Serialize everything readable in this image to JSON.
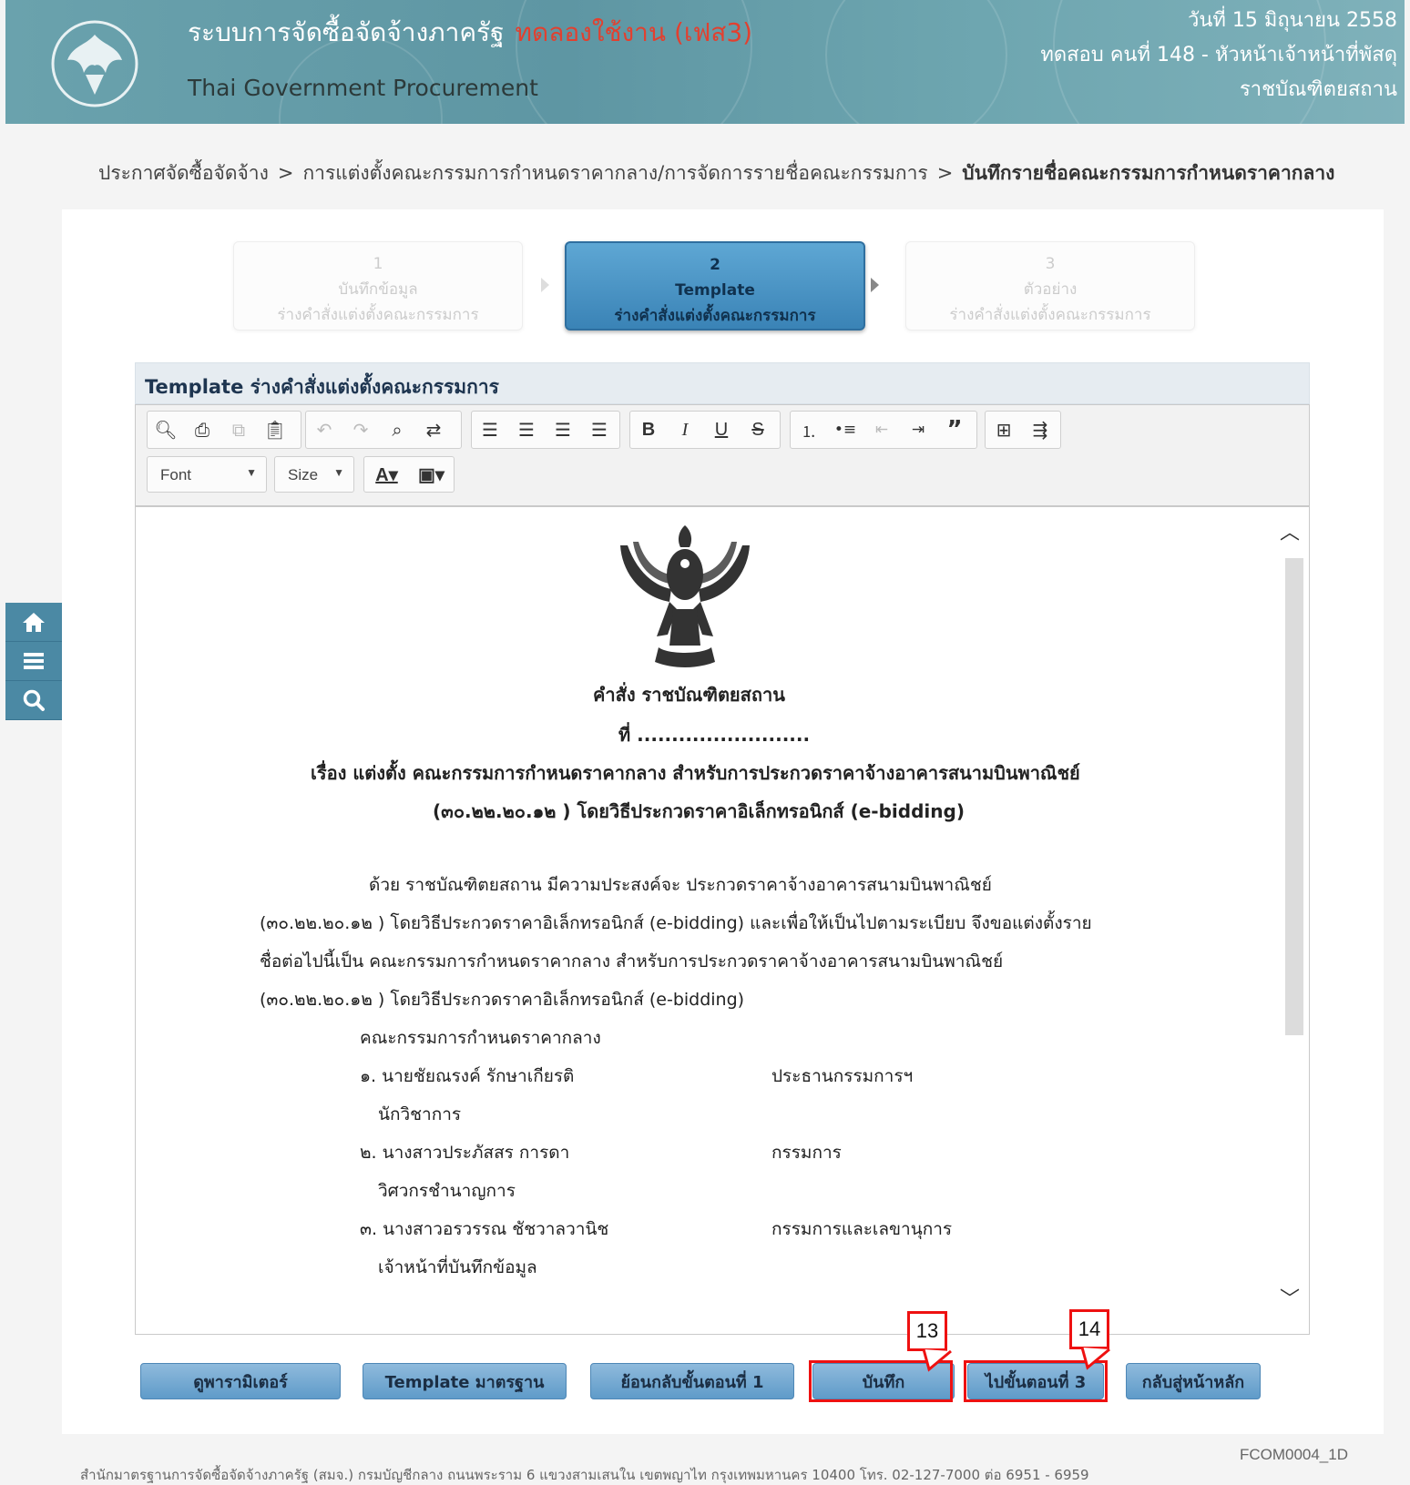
{
  "header": {
    "title": "ระบบการจัดซื้อจัดจ้างภาครัฐ",
    "trial_label": "ทดลองใช้งาน (เฟส3)",
    "subtitle": "Thai Government Procurement",
    "date": "วันที่ 15 มิถุนายน 2558",
    "user": "ทดสอบ คนที่ 148 - หัวหน้าเจ้าหน้าที่พัสดุ",
    "org": "ราชบัณฑิตยสถาน"
  },
  "breadcrumb": {
    "item1": "ประกาศจัดซื้อจัดจ้าง",
    "sep": ">",
    "item2": "การแต่งตั้งคณะกรรมการกำหนดราคากลาง/การจัดการรายชื่อคณะกรรมการ",
    "current": "บันทึกรายชื่อคณะกรรมการกำหนดราคากลาง"
  },
  "steps": [
    {
      "num": "1",
      "line1": "บันทึกข้อมูล",
      "line2": "ร่างคำสั่งแต่งตั้งคณะกรรมการ"
    },
    {
      "num": "2",
      "line1": "Template",
      "line2": "ร่างคำสั่งแต่งตั้งคณะกรรมการ"
    },
    {
      "num": "3",
      "line1": "ตัวอย่าง",
      "line2": "ร่างคำสั่งแต่งตั้งคณะกรรมการ"
    }
  ],
  "editor": {
    "title": "Template ร่างคำสั่งแต่งตั้งคณะกรรมการ",
    "font_label": "Font",
    "size_label": "Size"
  },
  "document": {
    "heading": "คำสั่ง ราชบัณฑิตยสถาน",
    "number": "ที่ .........................",
    "subject1": "เรื่อง แต่งตั้ง คณะกรรมการกำหนดราคากลาง สำหรับการประกวดราคาจ้างอาคารสนามบินพาณิชย์",
    "subject2": "(๓๐.๒๒.๒๐.๑๒ ) โดยวิธีประกวดราคาอิเล็กทรอนิกส์ (e-bidding)",
    "para1": "ด้วย ราชบัณฑิตยสถาน มีความประสงค์จะ ประกวดราคาจ้างอาคารสนามบินพาณิชย์",
    "para2": "(๓๐.๒๒.๒๐.๑๒ ) โดยวิธีประกวดราคาอิเล็กทรอนิกส์ (e-bidding)  และเพื่อให้เป็นไปตามระเบียบ จึงขอแต่งตั้งราย",
    "para3": "ชื่อต่อไปนี้เป็น คณะกรรมการกำหนดราคากลาง สำหรับการประกวดราคาจ้างอาคารสนามบินพาณิชย์",
    "para4": "(๓๐.๒๒.๒๐.๑๒ ) โดยวิธีประกวดราคาอิเล็กทรอนิกส์ (e-bidding)",
    "committee_title": "คณะกรรมการกำหนดราคากลาง",
    "members": [
      {
        "name": "๑. นายชัยณรงค์ รักษาเกียรติ",
        "position": "นักวิชาการ",
        "role": "ประธานกรรมการฯ"
      },
      {
        "name": "๒. นางสาวประภัสสร การดา",
        "position": "วิศวกรชำนาญการ",
        "role": "กรรมการ"
      },
      {
        "name": "๓. นางสาวอรวรรณ ชัชวาลวานิช",
        "position": "เจ้าหน้าที่บันทึกข้อมูล",
        "role": "กรรมการและเลขานุการ"
      }
    ]
  },
  "buttons": {
    "parameter": "ดูพารามิเตอร์",
    "template": "Template มาตรฐาน",
    "back": "ย้อนกลับขั้นตอนที่ 1",
    "save": "บันทึก",
    "next": "ไปขั้นตอนที่ 3",
    "home": "กลับสู่หน้าหลัก"
  },
  "callouts": {
    "save": "13",
    "next": "14"
  },
  "footer": {
    "text": "สำนักมาตรฐานการจัดซื้อจัดจ้างภาครัฐ (สมจ.) กรมบัญชีกลาง ถนนพระราม 6 แขวงสามเสนใน เขตพญาไท กรุงเทพมหานคร 10400 โทร. 02-127-7000 ต่อ 6951 - 6959",
    "code": "FCOM0004_1D"
  },
  "colors": {
    "header": "#6aa2ad",
    "trial": "#e2402f",
    "button": "#6fa6d0",
    "highlight": "#e11111"
  }
}
